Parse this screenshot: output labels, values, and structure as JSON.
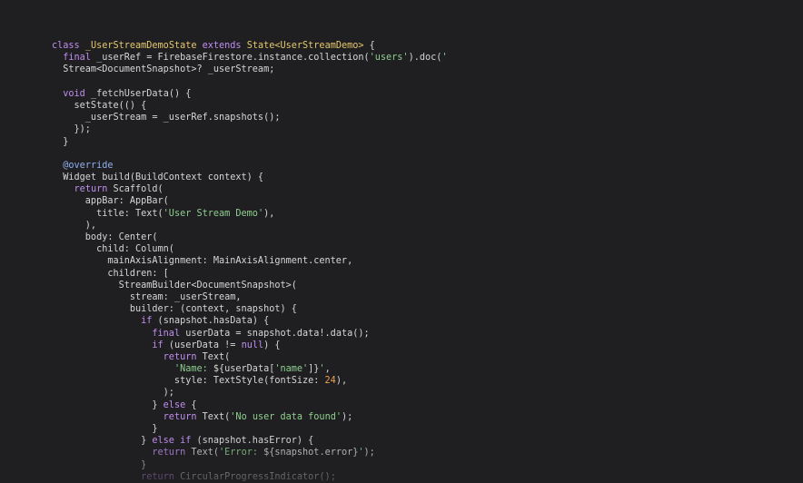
{
  "editor": {
    "lines": [
      [
        [
          "class",
          "kw"
        ],
        [
          " ",
          ""
        ],
        [
          "_UserStreamDemoState",
          "ty"
        ],
        [
          " ",
          ""
        ],
        [
          "extends",
          "kw"
        ],
        [
          " ",
          ""
        ],
        [
          "State<UserStreamDemo>",
          "ty"
        ],
        [
          " {",
          ""
        ]
      ],
      [
        [
          "  ",
          ""
        ],
        [
          "final",
          "kw"
        ],
        [
          " _userRef = FirebaseFirestore.instance.collection(",
          ""
        ],
        [
          "'users'",
          "st"
        ],
        [
          ").doc(",
          ""
        ],
        [
          "'",
          "st"
        ]
      ],
      [
        [
          "  Stream<DocumentSnapshot>? _userStream;",
          ""
        ]
      ],
      [],
      [
        [
          "  ",
          ""
        ],
        [
          "void",
          "kw"
        ],
        [
          " _fetchUserData() {",
          ""
        ]
      ],
      [
        [
          "    setState(() {",
          ""
        ]
      ],
      [
        [
          "      _userStream = _userRef.snapshots();",
          ""
        ]
      ],
      [
        [
          "    });",
          ""
        ]
      ],
      [
        [
          "  }",
          ""
        ]
      ],
      [],
      [
        [
          "  ",
          ""
        ],
        [
          "@override",
          "an"
        ]
      ],
      [
        [
          "  Widget build(BuildContext context) {",
          ""
        ]
      ],
      [
        [
          "    ",
          ""
        ],
        [
          "return",
          "kw"
        ],
        [
          " Scaffold(",
          ""
        ]
      ],
      [
        [
          "      appBar: AppBar(",
          ""
        ]
      ],
      [
        [
          "        title: Text(",
          ""
        ],
        [
          "'User Stream Demo'",
          "st"
        ],
        [
          "),",
          ""
        ]
      ],
      [
        [
          "      ),",
          ""
        ]
      ],
      [
        [
          "      body: Center(",
          ""
        ]
      ],
      [
        [
          "        child: Column(",
          ""
        ]
      ],
      [
        [
          "          mainAxisAlignment: MainAxisAlignment.center,",
          ""
        ]
      ],
      [
        [
          "          children: [",
          ""
        ]
      ],
      [
        [
          "            StreamBuilder<DocumentSnapshot>(",
          ""
        ]
      ],
      [
        [
          "              stream: _userStream,",
          ""
        ]
      ],
      [
        [
          "              builder: (context, snapshot) {",
          ""
        ]
      ],
      [
        [
          "                ",
          ""
        ],
        [
          "if",
          "kw"
        ],
        [
          " (snapshot.hasData) {",
          ""
        ]
      ],
      [
        [
          "                  ",
          ""
        ],
        [
          "final",
          "kw"
        ],
        [
          " userData = snapshot.data!.data();",
          ""
        ]
      ],
      [
        [
          "                  ",
          ""
        ],
        [
          "if",
          "kw"
        ],
        [
          " (userData != ",
          ""
        ],
        [
          "null",
          "kw"
        ],
        [
          ") {",
          ""
        ]
      ],
      [
        [
          "                    ",
          ""
        ],
        [
          "return",
          "kw"
        ],
        [
          " Text(",
          ""
        ]
      ],
      [
        [
          "                      ",
          ""
        ],
        [
          "'Name: ",
          "st"
        ],
        [
          "${userData[",
          ""
        ],
        [
          "'name'",
          "st"
        ],
        [
          "]}",
          ""
        ],
        [
          "'",
          "st"
        ],
        [
          ",",
          ""
        ]
      ],
      [
        [
          "                      style: TextStyle(fontSize: ",
          ""
        ],
        [
          "24",
          "nu"
        ],
        [
          "),",
          ""
        ]
      ],
      [
        [
          "                    );",
          ""
        ]
      ],
      [
        [
          "                  } ",
          ""
        ],
        [
          "else",
          "kw"
        ],
        [
          " {",
          ""
        ]
      ],
      [
        [
          "                    ",
          ""
        ],
        [
          "return",
          "kw"
        ],
        [
          " Text(",
          ""
        ],
        [
          "'No user data found'",
          "st"
        ],
        [
          ");",
          ""
        ]
      ],
      [
        [
          "                  }",
          ""
        ]
      ],
      [
        [
          "                } ",
          ""
        ],
        [
          "else if",
          "kw"
        ],
        [
          " (snapshot.hasError) {",
          ""
        ]
      ],
      [
        [
          "                  ",
          ""
        ],
        [
          "return",
          "kw"
        ],
        [
          " Text(",
          ""
        ],
        [
          "'Error: ",
          "st"
        ],
        [
          "${snapshot.error}",
          ""
        ],
        [
          "'",
          "st"
        ],
        [
          ");",
          ""
        ]
      ],
      [
        [
          "                }",
          ""
        ]
      ],
      [
        [
          "                ",
          ""
        ],
        [
          "return",
          "kw"
        ],
        [
          " CircularProgressIndicator();",
          ""
        ]
      ]
    ]
  },
  "colors": {
    "background": "#1f1f21",
    "keyword": "#c08ef0",
    "type": "#e6c86e",
    "string": "#8fcf8f",
    "annotation": "#8fb0f0",
    "number": "#f0a050",
    "text": "#d6d6d6"
  }
}
